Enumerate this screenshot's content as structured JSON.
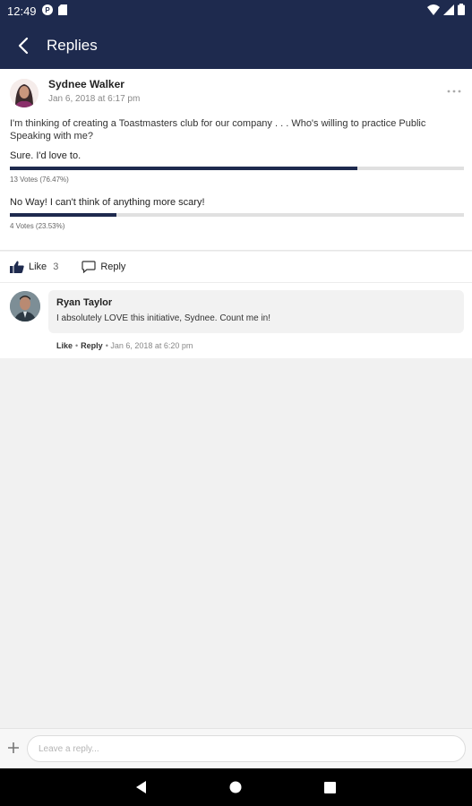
{
  "status_bar": {
    "time": "12:49"
  },
  "app_bar": {
    "title": "Replies"
  },
  "post": {
    "author": "Sydnee Walker",
    "date": "Jan 6, 2018 at 6:17 pm",
    "text": "I'm thinking of creating a Toastmasters club for our company . . . Who's willing to practice Public Speaking with me?",
    "poll": [
      {
        "label": "Sure. I'd love to.",
        "votes": "13 Votes (76.47%)",
        "percent": 76.47
      },
      {
        "label": "No Way! I can't think of anything more scary!",
        "votes": "4 Votes (23.53%)",
        "percent": 23.53
      }
    ]
  },
  "actions": {
    "like_label": "Like",
    "like_count": "3",
    "reply_label": "Reply"
  },
  "comment": {
    "author": "Ryan Taylor",
    "text": "I absolutely LOVE this initiative, Sydnee.  Count me in!",
    "like_label": "Like",
    "separator": "•",
    "reply_label": "Reply",
    "date": "• Jan 6, 2018 at 6:20 pm"
  },
  "reply_bar": {
    "placeholder": "Leave a reply..."
  },
  "colors": {
    "primary": "#1e2a4e",
    "track": "#e0e0e0"
  }
}
